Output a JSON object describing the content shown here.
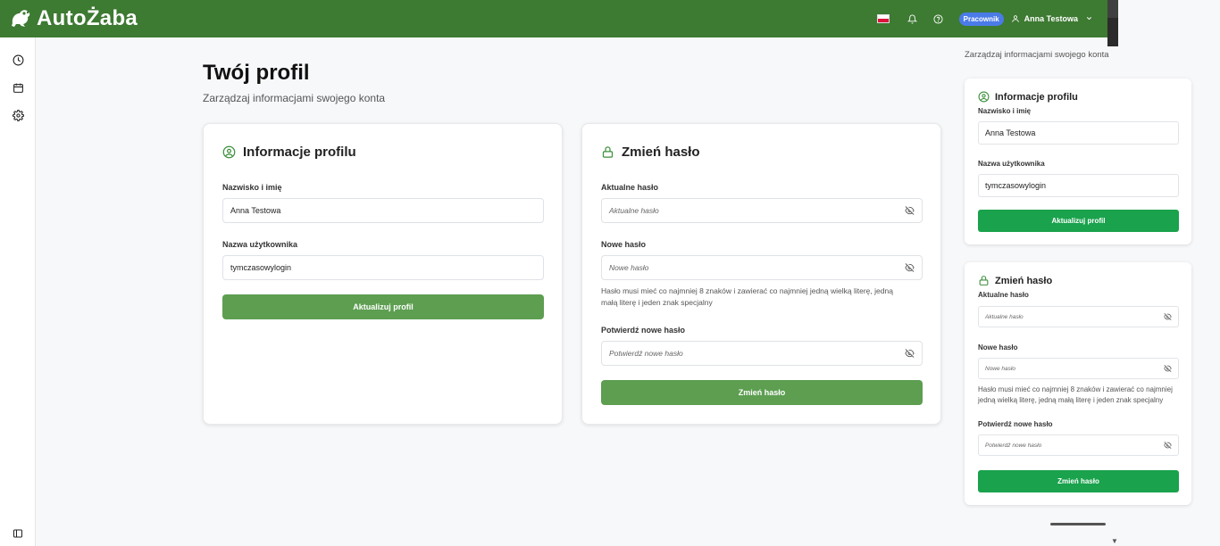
{
  "app": {
    "name": "AutoŻaba",
    "logo_icon": "frog-icon"
  },
  "topbar": {
    "language_flag": "pl-flag",
    "notification_icon": "bell-icon",
    "help_icon": "help-icon",
    "role_badge": "Pracownik",
    "user_icon": "user-icon",
    "user_name": "Anna Testowa",
    "chevron_icon": "chevron-down-icon"
  },
  "sidebar": {
    "items": [
      {
        "icon": "clock-icon"
      },
      {
        "icon": "calendar-icon"
      },
      {
        "icon": "gear-icon"
      }
    ],
    "bottom_icon": "panel-toggle-icon"
  },
  "page": {
    "title": "Twój profil",
    "subtitle": "Zarządzaj informacjami swojego konta"
  },
  "profile_card": {
    "title": "Informacje profilu",
    "icon": "user-circle-icon",
    "full_name_label": "Nazwisko i imię",
    "full_name_value": "Anna Testowa",
    "username_label": "Nazwa użytkownika",
    "username_value": "tymczasowylogin",
    "submit_label": "Aktualizuj profil"
  },
  "password_card": {
    "title": "Zmień hasło",
    "icon": "lock-icon",
    "current_label": "Aktualne hasło",
    "current_placeholder": "Aktualne hasło",
    "new_label": "Nowe hasło",
    "new_placeholder": "Nowe hasło",
    "hint_line1": "Hasło musi mieć co najmniej 8 znaków i zawierać co najmniej jedną wielką literę, jedną",
    "hint_line2": "małą literę i jeden znak specjalny",
    "confirm_label": "Potwierdź nowe hasło",
    "confirm_placeholder": "Potwierdź nowe hasło",
    "submit_label": "Zmień hasło",
    "eye_icon": "eye-off-icon"
  },
  "right_panel": {
    "subtitle": "Zarządzaj informacjami swojego konta",
    "profile_title": "Informacje profilu",
    "full_name_label": "Nazwisko i imię",
    "full_name_value": "Anna Testowa",
    "username_label": "Nazwa użytkownika",
    "username_value": "tymczasowylogin",
    "profile_submit": "Aktualizuj profil",
    "password_title": "Zmień hasło",
    "current_label": "Aktualne hasło",
    "current_placeholder": "Aktualne hasło",
    "new_label": "Nowe hasło",
    "new_placeholder": "Nowe hasło",
    "hint_line1": "Hasło musi mieć co najmniej 8 znaków i zawierać co najmniej",
    "hint_line2": "jedną wielką literę, jedną małą literę i jeden znak specjalny",
    "confirm_label": "Potwierdź nowe hasło",
    "confirm_placeholder": "Potwierdź nowe hasło",
    "password_submit": "Zmień hasło"
  },
  "colors": {
    "topbar": "#3d7a32",
    "button": "#5d9e51",
    "button_bright": "#1aa24d",
    "badge": "#4a7be8",
    "icon_green": "#3d8f3d"
  }
}
